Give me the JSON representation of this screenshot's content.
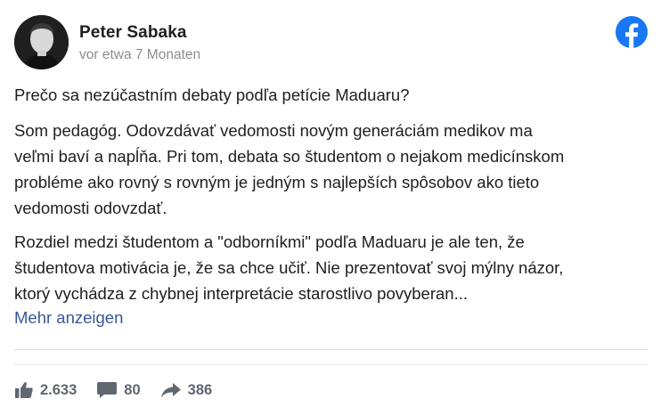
{
  "post": {
    "author": "Peter Sabaka",
    "timestamp": "vor etwa 7 Monaten",
    "title": "Prečo sa nezúčastním debaty podľa petície Maduaru?",
    "paragraph1": [
      "Som pedagóg. Odovzdávať vedomosti novým generáciám medikov ma",
      "veľmi baví a napĺňa. Pri tom, debata so študentom o nejakom medicínskom",
      "probléme ako rovný s rovným je jedným s najlepších spôsobov ako tieto",
      "vedomosti odovzdať."
    ],
    "paragraph2": [
      "Rozdiel medzi študentom a \"odborníkmi\" podľa Maduaru je ale ten, že",
      "študentova motivácia je, že sa chce učiť. Nie prezentovať svoj mýlny názor,",
      "ktorý vychádza z chybnej interpretácie starostlivo povyberan..."
    ],
    "show_more": "Mehr anzeigen"
  },
  "stats": {
    "likes": "2.633",
    "comments": "80",
    "shares": "386"
  },
  "colors": {
    "facebook_blue": "#1877f2",
    "link": "#385898",
    "muted": "#606770"
  },
  "icons": {
    "logo": "facebook-logo-icon",
    "like": "thumbs-up-icon",
    "comment": "comment-bubble-icon",
    "share": "share-arrow-icon"
  }
}
